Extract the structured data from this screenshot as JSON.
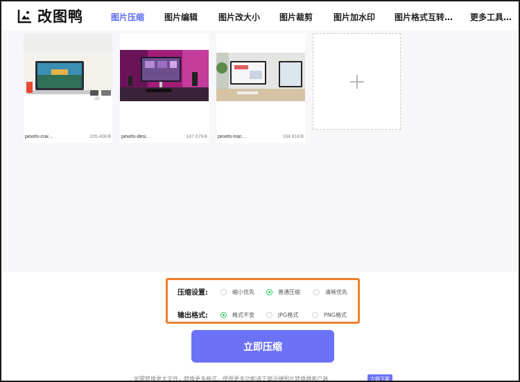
{
  "app": {
    "name": "改图鸭"
  },
  "nav": {
    "items": [
      {
        "label": "图片压缩",
        "active": true
      },
      {
        "label": "图片编辑",
        "active": false
      },
      {
        "label": "图片改大小",
        "active": false
      },
      {
        "label": "图片裁剪",
        "active": false
      },
      {
        "label": "图片加水印",
        "active": false
      },
      {
        "label": "图片格式互转…",
        "active": false
      },
      {
        "label": "更多工具…",
        "active": false
      }
    ]
  },
  "files": [
    {
      "name": "pexels-crai…",
      "size": "205.40KB"
    },
    {
      "name": "pexels-desi…",
      "size": "147.67KB"
    },
    {
      "name": "pexels-tran…",
      "size": "194.81KB"
    }
  ],
  "settings": {
    "compress_label": "压缩设置:",
    "compress_options": [
      {
        "label": "缩小优先",
        "checked": false
      },
      {
        "label": "普通压缩",
        "checked": true
      },
      {
        "label": "清晰优先",
        "checked": false
      }
    ],
    "format_label": "输出格式:",
    "format_options": [
      {
        "label": "格式不变",
        "checked": true
      },
      {
        "label": "JPG格式",
        "checked": false
      },
      {
        "label": "PNG格式",
        "checked": false
      }
    ]
  },
  "actions": {
    "compress_button": "立即压缩"
  },
  "footer": {
    "note": "· 如需转换更大文件，转换更多格式，使用更多功能请下载迅捷图片转换器客户端",
    "download_badge": "立即下载"
  },
  "colors": {
    "accent": "#6c72f5",
    "nav_active": "#5b6af5",
    "highlight_border": "#f07d2a",
    "radio_checked": "#22c55e"
  }
}
